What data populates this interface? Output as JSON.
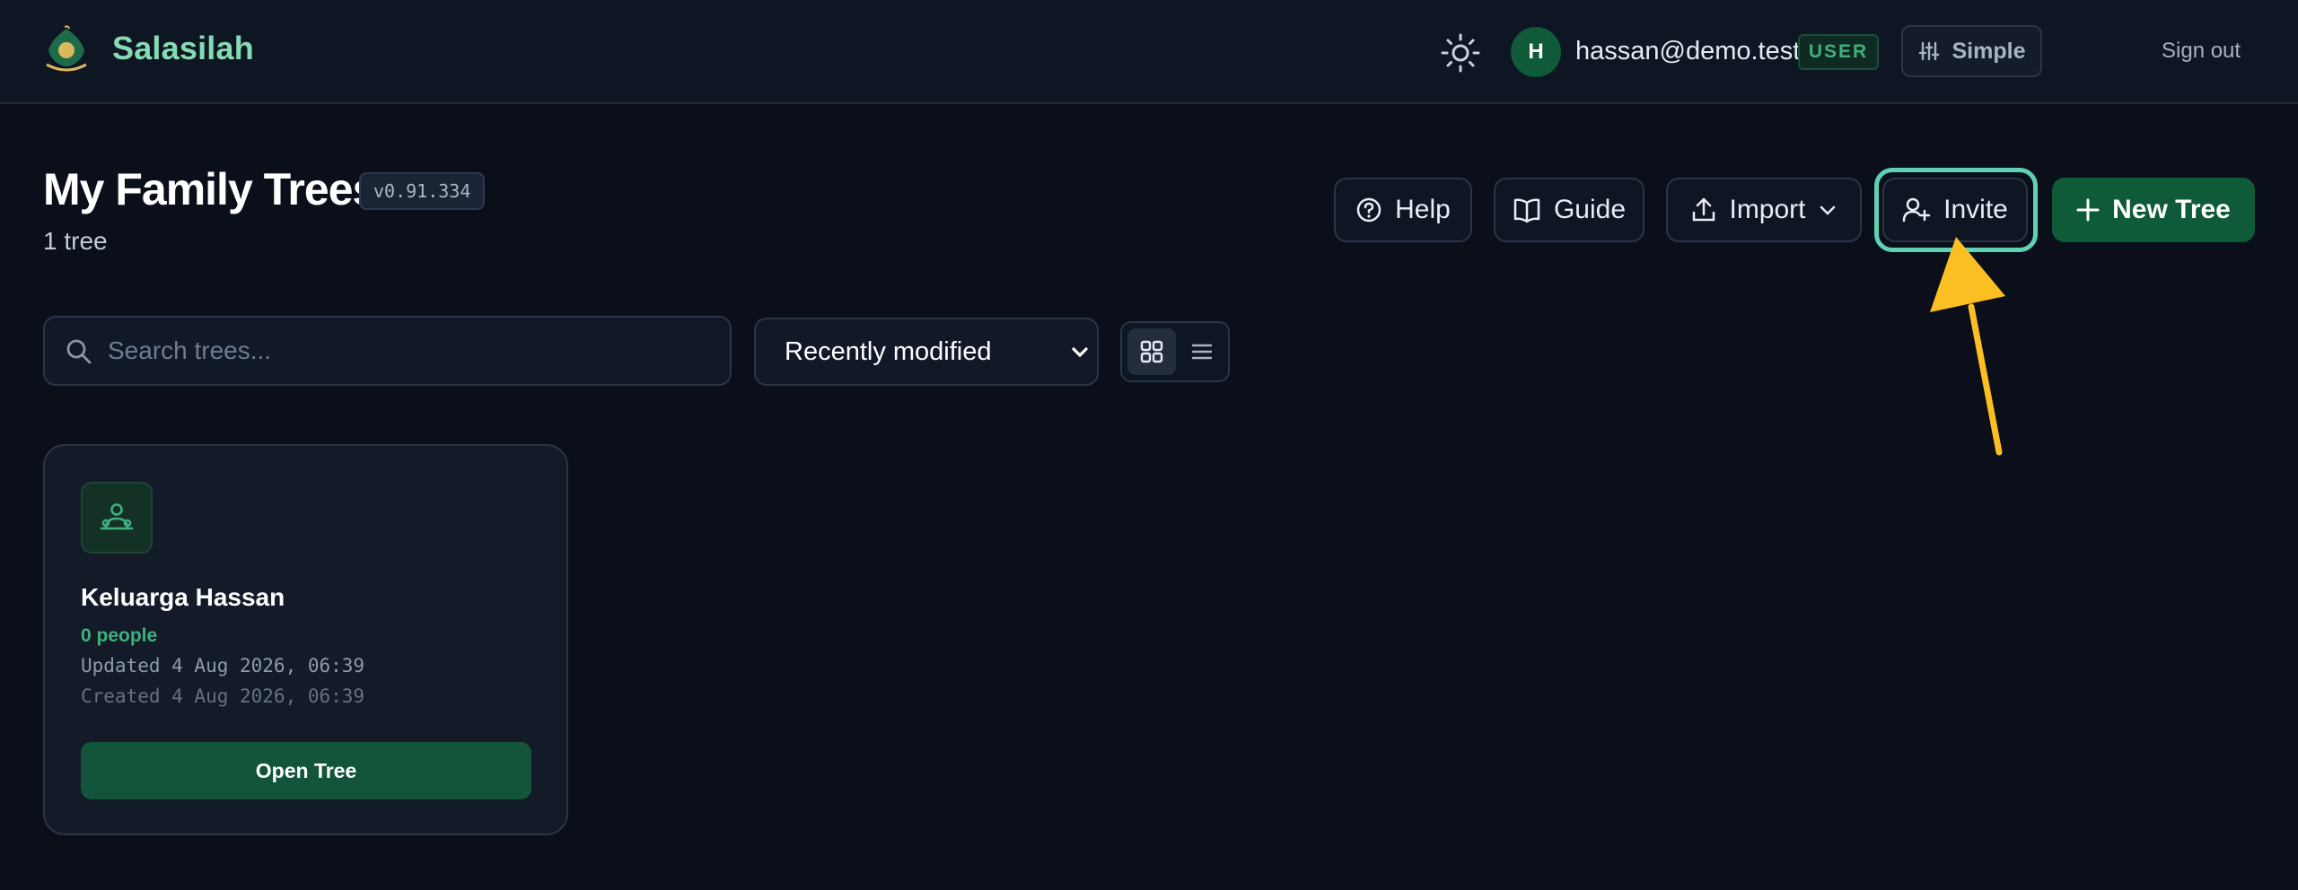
{
  "app": {
    "brand": "Salasilah"
  },
  "header": {
    "avatar_initial": "H",
    "user_email": "hassan@demo.test",
    "role_badge": "USER",
    "mode_label": "Simple",
    "sign_out_label": "Sign out"
  },
  "page": {
    "title": "My Family Trees",
    "version": "v0.91.334",
    "tree_count": "1 tree"
  },
  "actions": {
    "help_label": "Help",
    "guide_label": "Guide",
    "import_label": "Import",
    "invite_label": "Invite",
    "new_tree_label": "New Tree"
  },
  "filters": {
    "search_placeholder": "Search trees...",
    "sort_selected": "Recently modified"
  },
  "trees": [
    {
      "name": "Keluarga Hassan",
      "people": "0 people",
      "updated": "Updated 4 Aug 2026, 06:39",
      "created": "Created 4 Aug 2026, 06:39",
      "open_label": "Open Tree"
    }
  ],
  "colors": {
    "background": "#0a0f1a",
    "accent_green": "#0f5a38",
    "brand_mint": "#86dcb2",
    "highlight_ring": "#5fd2b3",
    "arrow_yellow": "#fbbf24"
  },
  "icons": {
    "logo": "tree-logo-icon",
    "theme": "sun-icon",
    "mode": "sliders-icon",
    "help": "question-circle-icon",
    "guide": "book-open-icon",
    "import": "upload-icon",
    "invite": "user-plus-icon",
    "new_tree": "plus-icon",
    "search": "search-icon",
    "grid_view": "grid-icon",
    "list_view": "list-icon",
    "tree_card": "family-icon"
  }
}
